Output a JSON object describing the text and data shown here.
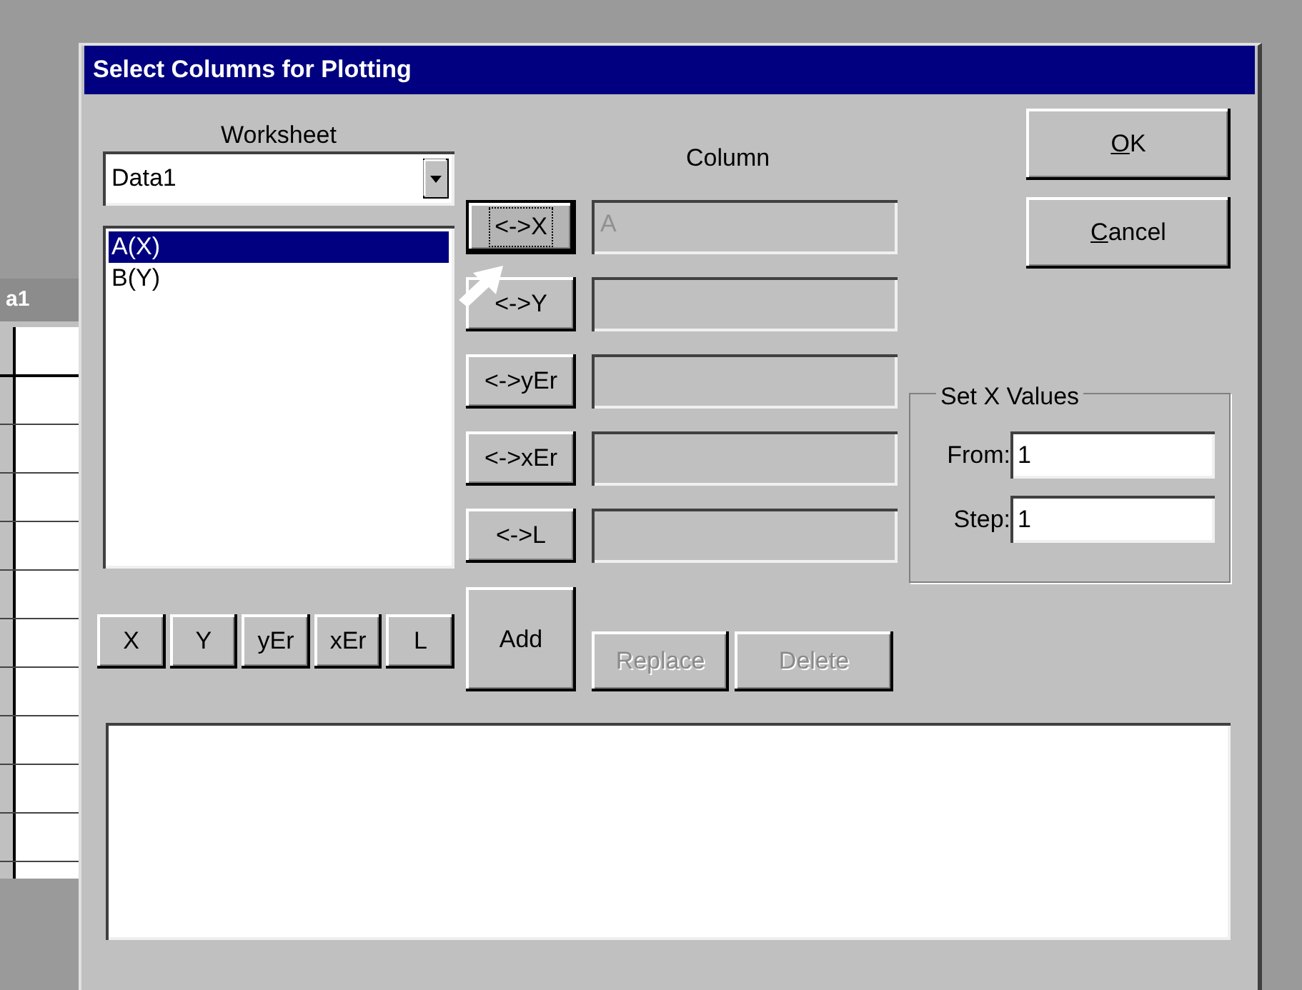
{
  "background_window": {
    "title": "a1"
  },
  "dialog": {
    "title": "Select Columns for Plotting"
  },
  "worksheet": {
    "label": "Worksheet",
    "value": "Data1"
  },
  "columns_list": [
    {
      "label": "A(X)",
      "selected": true
    },
    {
      "label": "B(Y)",
      "selected": false
    }
  ],
  "type_buttons": [
    "X",
    "Y",
    "yEr",
    "xEr",
    "L"
  ],
  "column_header": "Column",
  "assign_rows": [
    {
      "button": "<->X",
      "focused": true,
      "field": "A"
    },
    {
      "button": "<->Y",
      "focused": false
    },
    {
      "button": "<->yEr",
      "focused": false
    },
    {
      "button": "<->xEr",
      "focused": false
    },
    {
      "button": "<->L",
      "focused": false
    }
  ],
  "add_button": {
    "label": "Add",
    "disabled": false
  },
  "edit_buttons": [
    {
      "label": "Replace",
      "disabled": true
    },
    {
      "label": "Delete",
      "disabled": true
    }
  ],
  "dialog_buttons": [
    {
      "label": "OK",
      "first_letter_underlined": true
    },
    {
      "label": "Cancel",
      "first_letter_underlined": true
    }
  ],
  "set_x_values": {
    "title": "Set X Values",
    "fields": [
      {
        "label": "From:",
        "value": "1"
      },
      {
        "label": "Step:",
        "value": "1"
      }
    ]
  }
}
